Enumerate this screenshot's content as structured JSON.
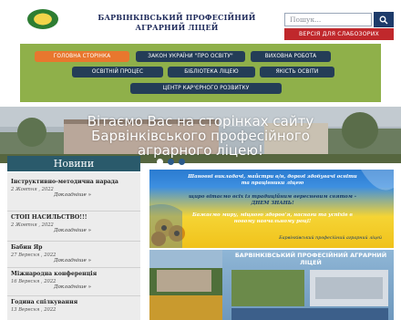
{
  "header": {
    "school_title": "БАРВІНКІВСЬКИЙ ПРОФЕСІЙНИЙ АГРАРНИЙ ЛІЦЕЙ",
    "search_placeholder": "Пошук...",
    "applicants_button": "ВЕРСІЯ ДЛЯ СЛАБОЗОРИХ",
    "search_icon": "search-icon",
    "logo_icon": "school-logo"
  },
  "nav": {
    "items": [
      "ГОЛОВНА СТОРІНКА",
      "ЗАКОН УКРАЇНИ \"ПРО ОСВІТУ\"",
      "ВИХОВНА РОБОТА",
      "ОСВІТНІЙ ПРОЦЕС",
      "БІБЛІОТЕКА ЛІЦЕЮ",
      "ЯКІСТЬ ОСВІТИ",
      "ЦЕНТР КАР'ЄРНОГО РОЗВИТКУ"
    ],
    "active_color": "#e8772e",
    "button_color": "#243d57",
    "bar_color": "#8fb04a"
  },
  "banner": {
    "text": "Вітаємо Вас на сторінках сайту Барвінківського професійного аграрного ліцею!"
  },
  "news": {
    "header": "Новини",
    "more_label": "Докладніше »",
    "items": [
      {
        "title": "Інструктивно-методична нарада",
        "date": "2 Жовтня , 2022"
      },
      {
        "title": "СТОП НАСИЛЬСТВО!!!",
        "date": "2 Жовтня , 2022"
      },
      {
        "title": "Бабин Яр",
        "date": "27 Вересня , 2022"
      },
      {
        "title": "Міжнародна конференція",
        "date": "16 Вересня , 2022"
      },
      {
        "title": "Година спілкування",
        "date": "13 Вересня , 2022"
      }
    ]
  },
  "poster": {
    "lines": [
      "Шановні викладачі, майстри в/н, дорогі здобувачі освіти та працівники ліцею",
      "щиро вітаємо всіх із традиційним вересневим святом - ДНЕМ ЗНАНЬ!",
      "Бажаємо миру, міцного здоров'я, наснаги та успіхів в новому навчальному році!"
    ],
    "signature": "Барвінківський професійний аграрний ліцей"
  },
  "info_card": {
    "title": "БАРВІНКІВСЬКИЙ ПРОФЕСІЙНИЙ АГРАРНИЙ ЛІЦЕЙ"
  }
}
